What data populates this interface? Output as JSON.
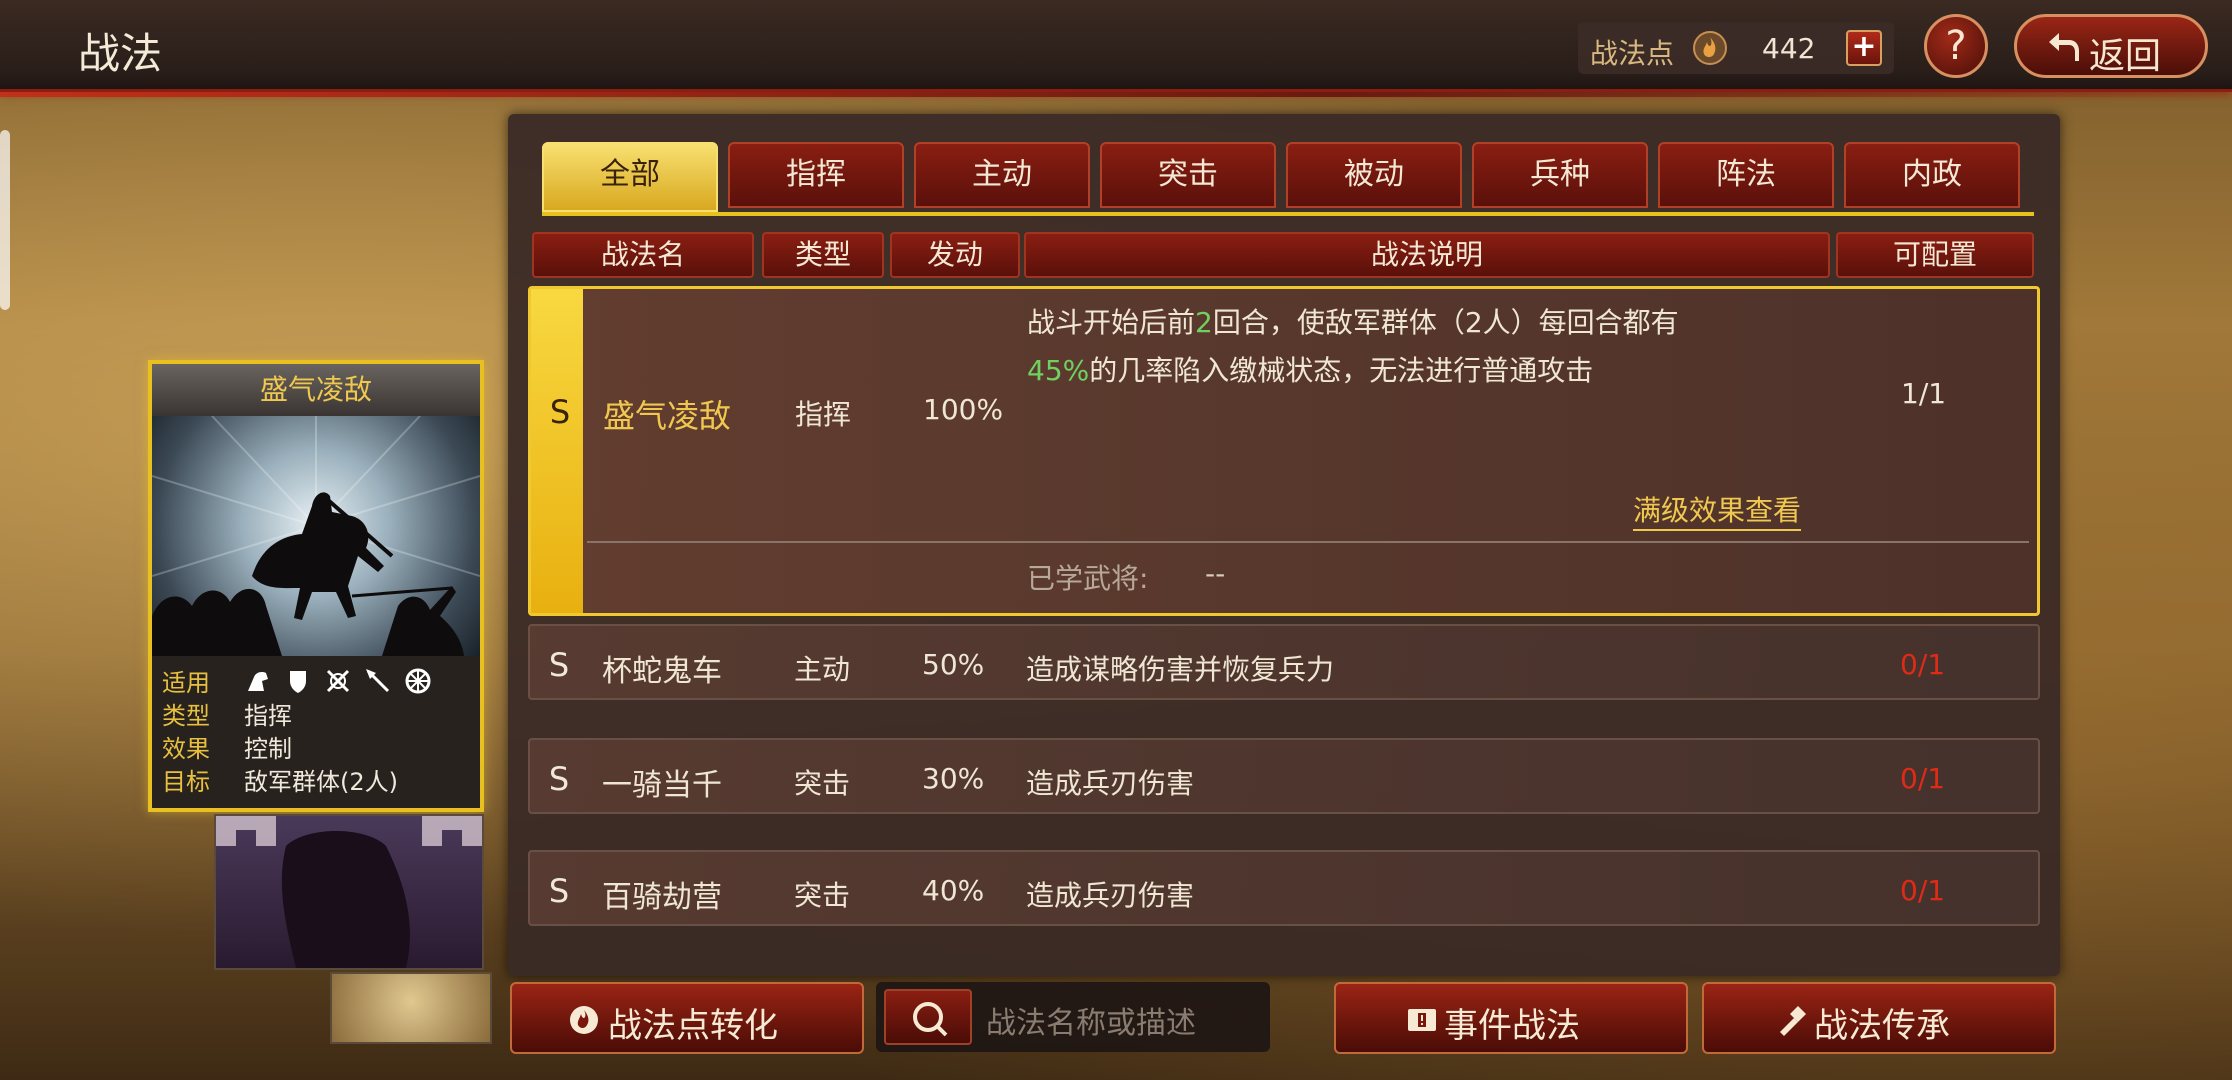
{
  "header": {
    "title": "战法",
    "points_label": "战法点",
    "points_value": "442",
    "plus_label": "+",
    "help_label": "?",
    "back_label": "返回"
  },
  "card": {
    "title": "盛气凌敌",
    "rows": [
      {
        "key": "适用",
        "value": ""
      },
      {
        "key": "类型",
        "value": "指挥"
      },
      {
        "key": "效果",
        "value": "控制"
      },
      {
        "key": "目标",
        "value": "敌军群体(2人)"
      }
    ],
    "unit_icons": [
      "cavalry-icon",
      "shield-icon",
      "archer-icon",
      "spear-icon",
      "siege-icon"
    ]
  },
  "tabs": [
    "全部",
    "指挥",
    "主动",
    "突击",
    "被动",
    "兵种",
    "阵法",
    "内政"
  ],
  "columns": [
    "战法名",
    "类型",
    "发动",
    "战法说明",
    "可配置"
  ],
  "selected": {
    "grade": "S",
    "name": "盛气凌敌",
    "type": "指挥",
    "rate": "100%",
    "desc_line1_a": "战斗开始后前",
    "desc_line1_num": "2",
    "desc_line1_b": "回合，使敌军群体（2人）每回合都有",
    "desc_line2_num": "45%",
    "desc_line2_b": "的几率陷入缴械状态，无法进行普通攻击",
    "config": "1/1",
    "full_effect": "满级效果查看",
    "learned_label": "已学武将:",
    "learned_value": "--"
  },
  "skills": [
    {
      "grade": "S",
      "name": "杯蛇鬼车",
      "type": "主动",
      "rate": "50%",
      "desc": "造成谋略伤害并恢复兵力",
      "config": "0/1"
    },
    {
      "grade": "S",
      "name": "一骑当千",
      "type": "突击",
      "rate": "30%",
      "desc": "造成兵刃伤害",
      "config": "0/1"
    },
    {
      "grade": "S",
      "name": "百骑劫营",
      "type": "突击",
      "rate": "40%",
      "desc": "造成兵刃伤害",
      "config": "0/1"
    }
  ],
  "bottom": {
    "convert_label": "战法点转化",
    "search_placeholder": "战法名称或描述",
    "event_label": "事件战法",
    "inherit_label": "战法传承"
  },
  "colors": {
    "accent": "#e8c020",
    "primary": "#8a1e12",
    "highlight": "#70d060",
    "warning": "#e02a18"
  }
}
